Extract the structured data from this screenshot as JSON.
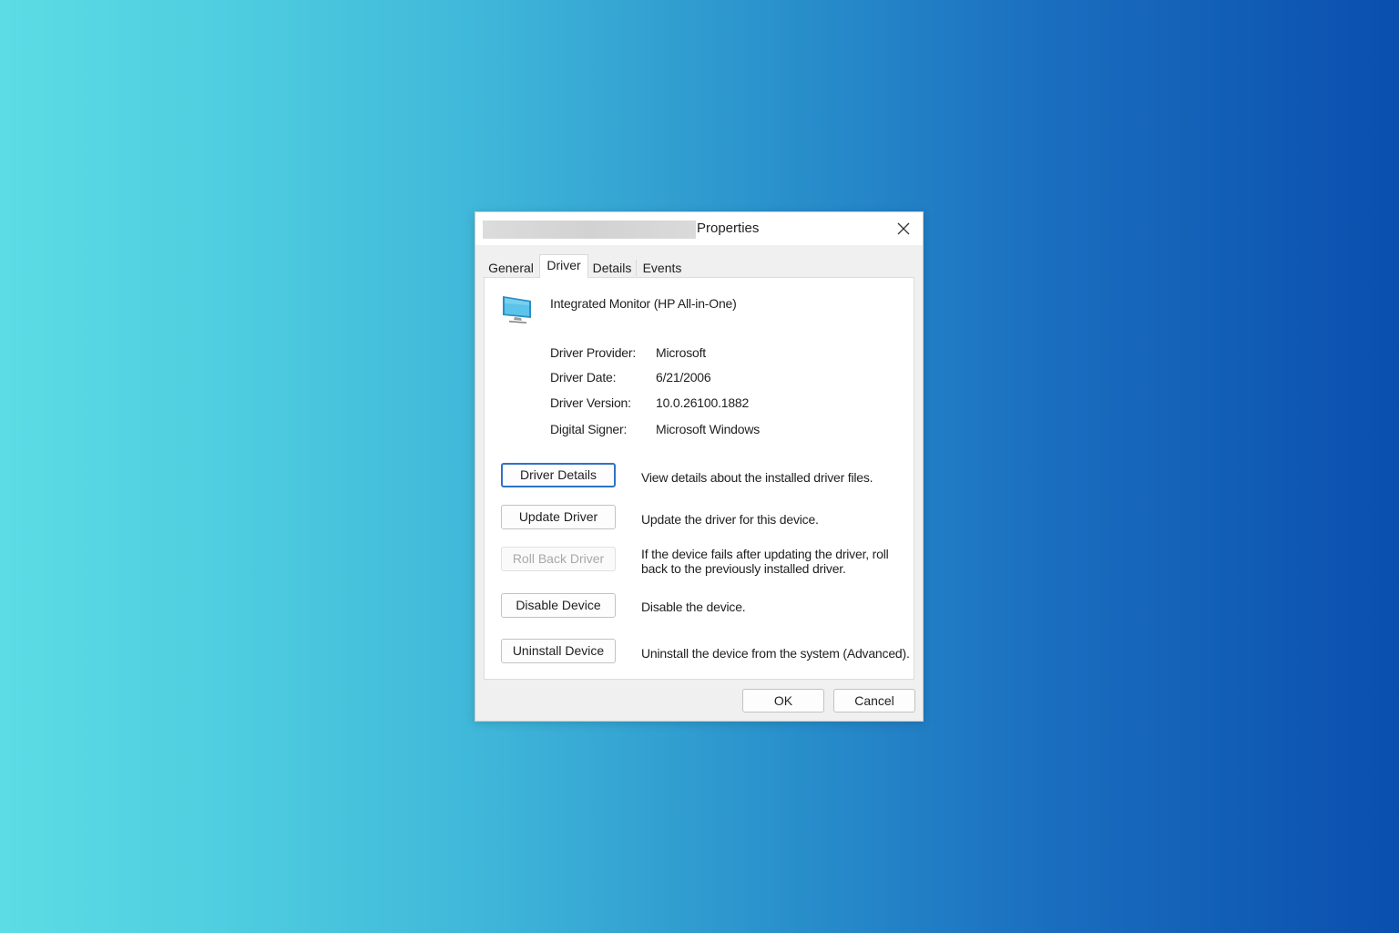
{
  "window": {
    "title": "Properties",
    "close_symbol": "×"
  },
  "tabs": [
    {
      "label": "General"
    },
    {
      "label": "Driver",
      "active": true
    },
    {
      "label": "Details"
    },
    {
      "label": "Events"
    }
  ],
  "device": {
    "icon": "monitor-icon",
    "name": "Integrated Monitor (HP All-in-One)"
  },
  "info": {
    "provider_label": "Driver Provider:",
    "provider_value": "Microsoft",
    "date_label": "Driver Date:",
    "date_value": "6/21/2006",
    "version_label": "Driver Version:",
    "version_value": "10.0.26100.1882",
    "signer_label": "Digital Signer:",
    "signer_value": "Microsoft Windows"
  },
  "actions": {
    "driver_details": {
      "label": "Driver Details",
      "desc": "View details about the installed driver files."
    },
    "update_driver": {
      "label": "Update Driver",
      "desc": "Update the driver for this device."
    },
    "roll_back": {
      "label": "Roll Back Driver",
      "desc": "If the device fails after updating the driver, roll back to the previously installed driver.",
      "enabled": false
    },
    "disable_device": {
      "label": "Disable Device",
      "desc": "Disable the device."
    },
    "uninstall_device": {
      "label": "Uninstall Device",
      "desc": "Uninstall the device from the system (Advanced)."
    }
  },
  "footer": {
    "ok_label": "OK",
    "cancel_label": "Cancel"
  },
  "colors": {
    "focus_border": "#2f73c5",
    "monitor_screen": "#3aa6d8"
  }
}
